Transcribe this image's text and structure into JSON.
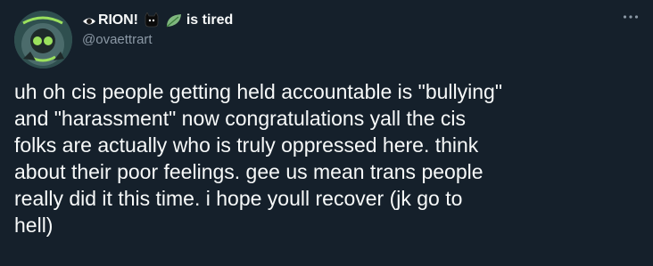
{
  "tweet": {
    "display_name": "RION!",
    "status": "is tired",
    "handle": "@ovaettrart",
    "text_lines": [
      "uh oh cis people getting held accountable is \"bullying\"",
      "and \"harassment\" now congratulations yall the cis",
      "folks are actually who is truly oppressed here. think",
      "about their poor feelings. gee us mean trans people",
      "really did it this time. i hope youll recover (jk go to",
      "hell)"
    ]
  },
  "icons": {
    "name_prefix": "eye-icon",
    "emoji_1": "black-cat-icon",
    "emoji_2": "leaf-icon",
    "more": "more-options-icon"
  },
  "colors": {
    "background": "#15202b",
    "text": "#f7f9f9",
    "secondary_text": "#8b98a5"
  }
}
